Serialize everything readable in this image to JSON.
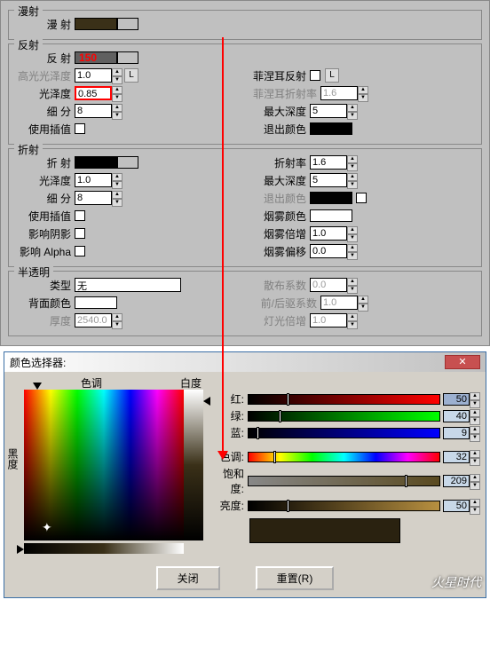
{
  "diffuse": {
    "title": "漫射",
    "label": "漫  射",
    "color": "#3a3018"
  },
  "reflect": {
    "title": "反射",
    "label": "反  射",
    "annotation": "150",
    "color": "#606060",
    "hilight_gloss_label": "高光光泽度",
    "hilight_gloss": "1.0",
    "refl_gloss_label": "光泽度",
    "refl_gloss": "0.85",
    "subdiv_label": "细  分",
    "subdiv": "8",
    "interp_label": "使用插值",
    "fresnel_label": "菲涅耳反射",
    "fresnel_ior_label": "菲涅耳折射率",
    "fresnel_ior": "1.6",
    "max_depth_label": "最大深度",
    "max_depth": "5",
    "exit_color_label": "退出颜色",
    "exit_color": "#000000"
  },
  "refract": {
    "title": "折射",
    "label": "折  射",
    "color": "#000000",
    "gloss_label": "光泽度",
    "gloss": "1.0",
    "subdiv_label": "细  分",
    "subdiv": "8",
    "interp_label": "使用插值",
    "shadows_label": "影响阴影",
    "alpha_label": "影响 Alpha",
    "ior_label": "折射率",
    "ior": "1.6",
    "max_depth_label": "最大深度",
    "max_depth": "5",
    "exit_color_label": "退出颜色",
    "exit_color": "#000000",
    "fog_color_label": "烟雾颜色",
    "fog_color": "#ffffff",
    "fog_mult_label": "烟雾倍增",
    "fog_mult": "1.0",
    "fog_bias_label": "烟雾偏移",
    "fog_bias": "0.0"
  },
  "translucency": {
    "title": "半透明",
    "type_label": "类型",
    "type": "无",
    "back_color_label": "背面颜色",
    "back_color": "#ffffff",
    "thick_label": "厚度",
    "thick": "2540.0",
    "scatter_label": "散布系数",
    "scatter": "0.0",
    "fb_label": "前/后驱系数",
    "fb": "1.0",
    "light_mult_label": "灯光倍增",
    "light_mult": "1.0"
  },
  "picker": {
    "title": "颜色选择器:",
    "hue_axis": "色调",
    "white_axis": "白度",
    "black_axis": "黑度",
    "r_label": "红:",
    "g_label": "绿:",
    "b_label": "蓝:",
    "h_label": "色调:",
    "s_label": "饱和度:",
    "v_label": "亮度:",
    "r": "50",
    "g": "40",
    "b": "9",
    "h": "32",
    "s": "209",
    "v": "50",
    "close": "关闭",
    "reset": "重置(R)"
  },
  "watermark": "火星时代",
  "L": "L"
}
